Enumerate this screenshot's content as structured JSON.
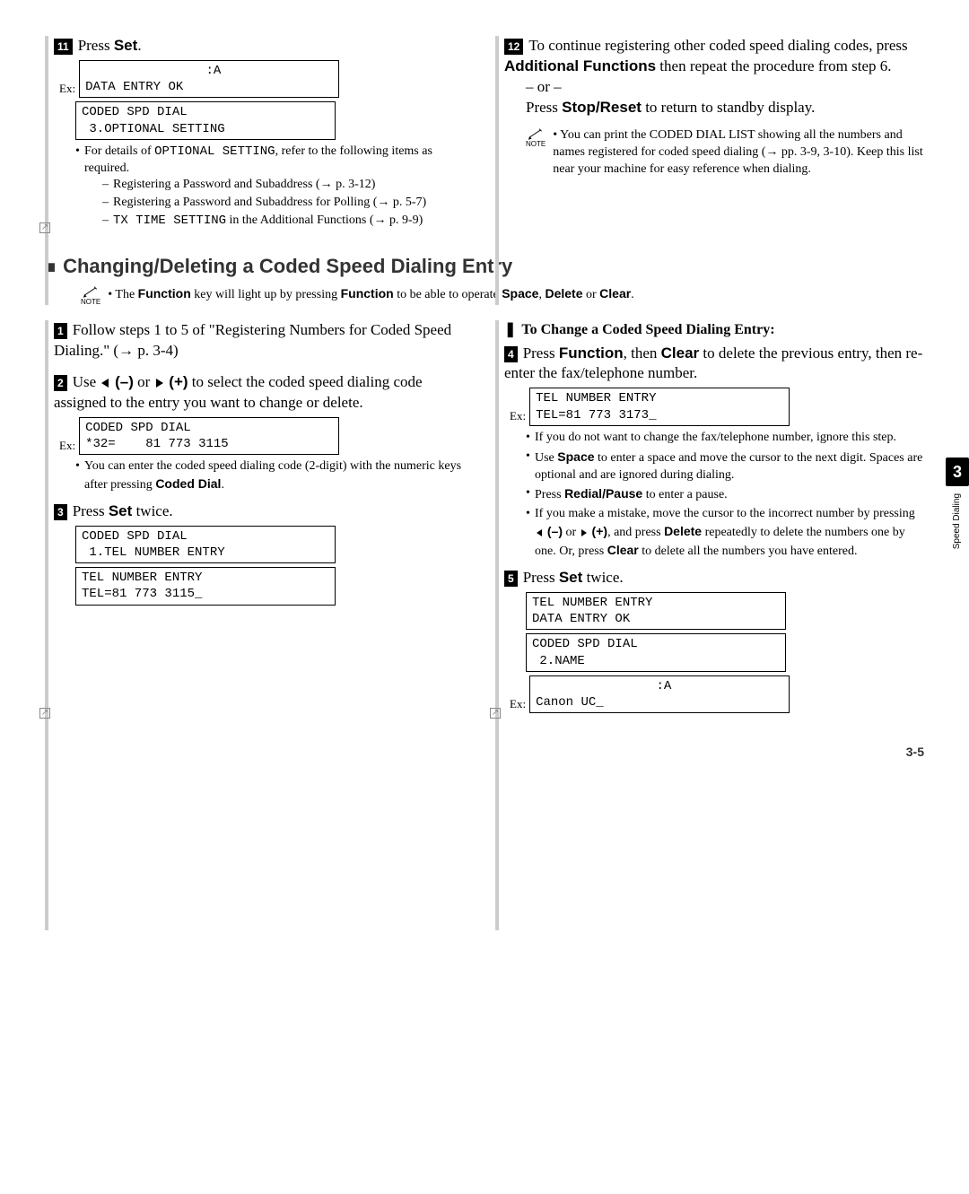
{
  "c11": {
    "num": "11",
    "title_a": "Press ",
    "title_b": "Set",
    "title_c": ".",
    "lcd1_a": "                :A",
    "lcd1_b": "DATA ENTRY OK",
    "lcd2_a": "CODED SPD DIAL",
    "lcd2_b": " 3.OPTIONAL SETTING",
    "b1_a": "For details of ",
    "b1_b": "OPTIONAL SETTING",
    "b1_c": ", refer to the following items as required.",
    "d1": "Registering a Password and Subaddress (→ p. 3-12)",
    "d2": "Registering a Password and Subaddress for Polling (→ p. 5-7)",
    "d3_a": "TX TIME SETTING",
    "d3_b": " in the Additional Functions (→ p. 9-9)",
    "ex": "Ex:"
  },
  "c12": {
    "num": "12",
    "p1_a": "To continue registering other coded speed dialing codes, press ",
    "p1_b": "Additional Functions",
    "p1_c": " then repeat the procedure from step 6.",
    "or": "– or –",
    "p2_a": "Press ",
    "p2_b": "Stop/Reset",
    "p2_c": " to return to standby display.",
    "note_label": "NOTE",
    "note": "You can print the CODED DIAL LIST showing all the numbers and names registered for coded speed dialing (→ pp. 3-9, 3-10). Keep this list near your machine for easy reference when dialing."
  },
  "section": {
    "head": "Changing/Deleting a Coded Speed Dialing Entry",
    "note_label": "NOTE",
    "intro_a": "The ",
    "intro_b": "Function",
    "intro_c": " key will light up by pressing ",
    "intro_d": "Function",
    "intro_e": " to be able to operate ",
    "intro_f": "Space",
    "intro_g": ", ",
    "intro_h": "Delete",
    "intro_i": " or ",
    "intro_j": "Clear",
    "intro_k": "."
  },
  "s1": {
    "num": "1",
    "text": "Follow steps 1 to 5 of \"Registering Numbers for Coded Speed Dialing.\" (→ p. 3-4)"
  },
  "s2": {
    "num": "2",
    "a": "Use ",
    "b": " (–)",
    "c": " or ",
    "d": " (+)",
    "e": " to select the coded speed dialing code assigned to the entry you want to change or delete.",
    "ex": "Ex:",
    "lcd_a": "CODED SPD DIAL",
    "lcd_b": "*32=    81 773 3115",
    "bul_a": "You can enter the coded speed dialing code (2-digit) with the numeric keys after pressing ",
    "bul_b": "Coded Dial",
    "bul_c": "."
  },
  "s3": {
    "num": "3",
    "a": "Press ",
    "b": "Set",
    "c": " twice.",
    "lcd1_a": "CODED SPD DIAL",
    "lcd1_b": " 1.TEL NUMBER ENTRY",
    "lcd2_a": "TEL NUMBER ENTRY",
    "lcd2_b": "TEL=81 773 3115_"
  },
  "rhead": {
    "text": "To Change a Coded Speed Dialing Entry:"
  },
  "s4": {
    "num": "4",
    "a": "Press ",
    "b": "Function",
    "c": ", then ",
    "d": "Clear",
    "e": " to delete the previous entry, then re-enter the fax/telephone number.",
    "ex": "Ex:",
    "lcd_a": "TEL NUMBER ENTRY",
    "lcd_b": "TEL=81 773 3173_",
    "b1": "If you do not want to change the fax/telephone number, ignore this step.",
    "b2_a": "Use ",
    "b2_b": "Space",
    "b2_c": " to enter a space and move the cursor to the next digit. Spaces are optional and are ignored during dialing.",
    "b3_a": "Press ",
    "b3_b": "Redial/Pause",
    "b3_c": " to enter a pause.",
    "b4_a": "If you make a mistake, move the cursor to the incorrect number by pressing ",
    "b4_b": " (–)",
    "b4_c": " or ",
    "b4_d": " (+)",
    "b4_e": ", and press ",
    "b4_f": "Delete",
    "b4_g": " repeatedly to delete the numbers one by one. Or, press ",
    "b4_h": "Clear",
    "b4_i": " to delete all the numbers you have entered."
  },
  "s5": {
    "num": "5",
    "a": "Press ",
    "b": "Set",
    "c": " twice.",
    "lcd1_a": "TEL NUMBER ENTRY",
    "lcd1_b": "DATA ENTRY OK",
    "lcd2_a": "CODED SPD DIAL",
    "lcd2_b": " 2.NAME",
    "ex": "Ex:",
    "lcd3_a": "                :A",
    "lcd3_b": "Canon UC_"
  },
  "sidebar": {
    "num": "3",
    "label": "Speed Dialing"
  },
  "pagenum": "3-5"
}
